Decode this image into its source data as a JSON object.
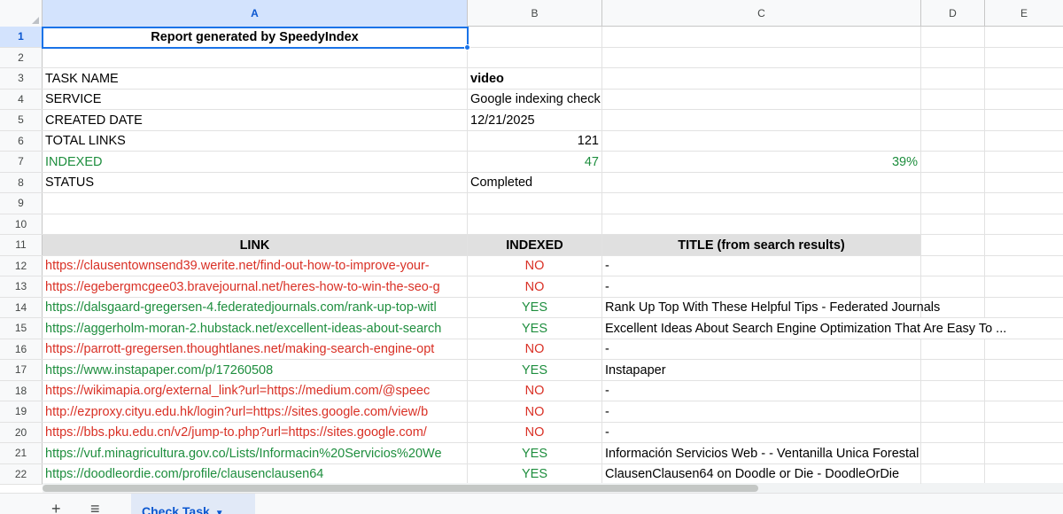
{
  "columns": [
    "A",
    "B",
    "C",
    "D",
    "E"
  ],
  "rows": [
    "1",
    "2",
    "3",
    "4",
    "5",
    "6",
    "7",
    "8",
    "9",
    "10",
    "11",
    "12",
    "13",
    "14",
    "15",
    "16",
    "17",
    "18",
    "19",
    "20",
    "21",
    "22"
  ],
  "title": "Report generated by SpeedyIndex",
  "summary": {
    "task_name_label": "TASK NAME",
    "task_name": "video",
    "service_label": "SERVICE",
    "service": "Google indexing check",
    "created_label": "CREATED DATE",
    "created": "12/21/2025",
    "total_label": "TOTAL LINKS",
    "total": "121",
    "indexed_label": "INDEXED",
    "indexed": "47",
    "indexed_pct": "39%",
    "status_label": "STATUS",
    "status": "Completed"
  },
  "table_headers": {
    "link": "LINK",
    "indexed": "INDEXED",
    "title": "TITLE (from search results)"
  },
  "links": [
    {
      "url": "https://clausentownsend39.werite.net/find-out-how-to-improve-your-",
      "indexed": "NO",
      "title": "-"
    },
    {
      "url": "https://egebergmcgee03.bravejournal.net/heres-how-to-win-the-seo-g",
      "indexed": "NO",
      "title": "-"
    },
    {
      "url": "https://dalsgaard-gregersen-4.federatedjournals.com/rank-up-top-witl",
      "indexed": "YES",
      "title": "Rank Up Top With These Helpful Tips - Federated Journals"
    },
    {
      "url": "https://aggerholm-moran-2.hubstack.net/excellent-ideas-about-search",
      "indexed": "YES",
      "title": "Excellent Ideas About Search Engine Optimization That Are Easy To ..."
    },
    {
      "url": "https://parrott-gregersen.thoughtlanes.net/making-search-engine-opt",
      "indexed": "NO",
      "title": "-"
    },
    {
      "url": "https://www.instapaper.com/p/17260508",
      "indexed": "YES",
      "title": "Instapaper"
    },
    {
      "url": "https://wikimapia.org/external_link?url=https://medium.com/@speec",
      "indexed": "NO",
      "title": "-"
    },
    {
      "url": "http://ezproxy.cityu.edu.hk/login?url=https://sites.google.com/view/b",
      "indexed": "NO",
      "title": "-"
    },
    {
      "url": "https://bbs.pku.edu.cn/v2/jump-to.php?url=https://sites.google.com/",
      "indexed": "NO",
      "title": "-"
    },
    {
      "url": "https://vuf.minagricultura.gov.co/Lists/Informacin%20Servicios%20We",
      "indexed": "YES",
      "title": "Información Servicios Web - - Ventanilla Unica Forestal"
    },
    {
      "url": "https://doodleordie.com/profile/clausenclausen64",
      "indexed": "YES",
      "title": "ClausenClausen64 on Doodle or Die - DoodleOrDie"
    }
  ],
  "sheet_tab": {
    "label": "Check Task"
  },
  "colors": {
    "yes": "#1e8e3e",
    "no": "#d93025",
    "selection": "#1a73e8",
    "tab": "#0b57d0"
  }
}
